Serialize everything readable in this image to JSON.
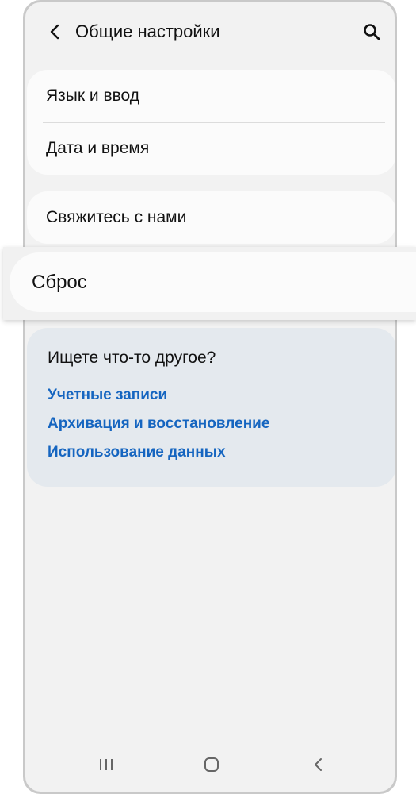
{
  "header": {
    "title": "Общие настройки",
    "back_icon": "chevron-left-icon",
    "search_icon": "search-icon"
  },
  "group1": {
    "items": [
      {
        "label": "Язык и ввод"
      },
      {
        "label": "Дата и время"
      }
    ]
  },
  "group2": {
    "items": [
      {
        "label": "Свяжитесь с нами"
      }
    ]
  },
  "highlighted": {
    "label": "Сброс"
  },
  "suggestions": {
    "title": "Ищете что-то другое?",
    "links": [
      {
        "label": "Учетные записи"
      },
      {
        "label": "Архивация и восстановление"
      },
      {
        "label": "Использование данных"
      }
    ]
  },
  "navbar": {
    "recent_icon": "recent-apps-icon",
    "home_icon": "home-icon",
    "back_icon": "back-icon"
  },
  "colors": {
    "link": "#1565c0",
    "screen_bg": "#f2f2f2",
    "card_bg": "#fbfbfb",
    "suggest_bg": "#e4e9ee"
  }
}
